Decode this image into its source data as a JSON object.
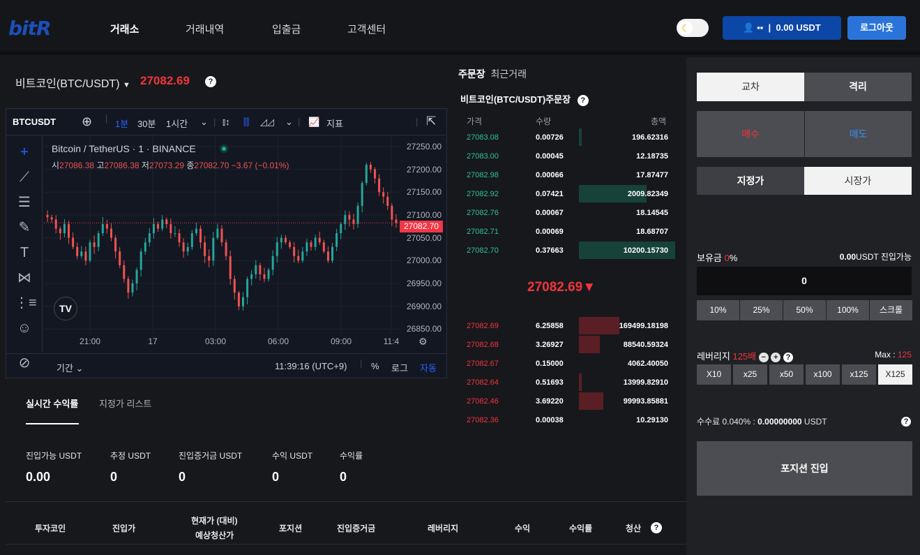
{
  "header": {
    "logo": "bitR",
    "nav": [
      "거래소",
      "거래내역",
      "입출금",
      "고객센터"
    ],
    "account_label": "0.00 USDT",
    "logout": "로그아웃"
  },
  "pair": {
    "title": "비트코인(BTC/USDT)",
    "price": "27082.69"
  },
  "chart": {
    "symbol": "BTCUSDT",
    "intervals": [
      "1분",
      "30분",
      "1시간"
    ],
    "indicator": "지표",
    "series_title": "Bitcoin / TetherUS · 1 · BINANCE",
    "ohlc": {
      "o_label": "시",
      "o": "27086.38",
      "h_label": "고",
      "h": "27086.38",
      "l_label": "저",
      "l": "27073.29",
      "c_label": "종",
      "c": "27082.70 −3.67 (−0.01%)"
    },
    "last_price_tag": "27082.70",
    "range_label": "기간",
    "time": "11:39:16 (UTC+9)",
    "percent": "%",
    "log": "로그",
    "auto": "자동"
  },
  "chart_data": {
    "type": "candlestick",
    "title": "Bitcoin / TetherUS · 1 · BINANCE",
    "x_ticks": [
      "21:00",
      "17",
      "03:00",
      "06:00",
      "09:00",
      "11:4"
    ],
    "y_ticks": [
      "27250.00",
      "27200.00",
      "27150.00",
      "27100.00",
      "27050.00",
      "27000.00",
      "26950.00",
      "26900.00",
      "26850.00"
    ],
    "ylim": [
      26840,
      27265
    ],
    "grid": true,
    "close_series": [
      27095,
      27090,
      27070,
      27060,
      27080,
      27050,
      27030,
      27010,
      27020,
      27000,
      27040,
      27030,
      27060,
      27080,
      27070,
      27050,
      27020,
      26990,
      26960,
      26930,
      26950,
      26980,
      27020,
      27040,
      27060,
      27080,
      27070,
      27090,
      27080,
      27060,
      27060,
      27040,
      27020,
      27030,
      27060,
      27070,
      27040,
      27010,
      27000,
      27050,
      27070,
      27040,
      27010,
      26960,
      26930,
      26900,
      26920,
      26960,
      26970,
      26990,
      26970,
      26960,
      26980,
      27010,
      27040,
      27050,
      27040,
      27030,
      27010,
      27000,
      27020,
      27040,
      27030,
      27050,
      27040,
      27020,
      27000,
      27030,
      27060,
      27080,
      27100,
      27090,
      27080,
      27120,
      27170,
      27210,
      27200,
      27180,
      27150,
      27140,
      27120,
      27090,
      27082
    ]
  },
  "orderbook": {
    "tab_active": "주문장",
    "tab_other": "최근거래",
    "title": "비트코인(BTC/USDT)주문장",
    "col_price": "가격",
    "col_qty": "수량",
    "col_total": "총액",
    "asks": [
      {
        "price": "27083.08",
        "qty": "0.00726",
        "total": "196.62316",
        "depth": 0.03
      },
      {
        "price": "27083.00",
        "qty": "0.00045",
        "total": "12.18735",
        "depth": 0.0
      },
      {
        "price": "27082.98",
        "qty": "0.00066",
        "total": "17.87477",
        "depth": 0.0
      },
      {
        "price": "27082.92",
        "qty": "0.07421",
        "total": "2009.82349",
        "depth": 0.7
      },
      {
        "price": "27082.76",
        "qty": "0.00067",
        "total": "18.14545",
        "depth": 0.0
      },
      {
        "price": "27082.71",
        "qty": "0.00069",
        "total": "18.68707",
        "depth": 0.0
      },
      {
        "price": "27082.70",
        "qty": "0.37663",
        "total": "10200.15730",
        "depth": 1.0
      }
    ],
    "mid_price": "27082.69▼",
    "bids": [
      {
        "price": "27082.69",
        "qty": "6.25858",
        "total": "169499.18198",
        "depth": 0.42
      },
      {
        "price": "27082.68",
        "qty": "3.26927",
        "total": "88540.59324",
        "depth": 0.22
      },
      {
        "price": "27082.67",
        "qty": "0.15000",
        "total": "4062.40050",
        "depth": 0.0
      },
      {
        "price": "27082.64",
        "qty": "0.51693",
        "total": "13999.82910",
        "depth": 0.03
      },
      {
        "price": "27082.46",
        "qty": "3.69220",
        "total": "99993.85881",
        "depth": 0.25
      },
      {
        "price": "27082.36",
        "qty": "0.00038",
        "total": "10.29130",
        "depth": 0.0
      }
    ]
  },
  "positions": {
    "tab_active": "실시간 수익률",
    "tab_other": "지정가 리스트",
    "stats": [
      {
        "label": "진입가능 USDT",
        "value": "0.00"
      },
      {
        "label": "추정 USDT",
        "value": "0"
      },
      {
        "label": "진입증거금 USDT",
        "value": "0"
      },
      {
        "label": "수익 USDT",
        "value": "0"
      },
      {
        "label": "수익률",
        "value": "0"
      }
    ],
    "columns": [
      "투자코인",
      "진입가",
      "현재가 (대비)",
      "예상청산가",
      "포지션",
      "진입증거금",
      "레버리지",
      "수익",
      "수익률",
      "청산"
    ]
  },
  "trade": {
    "margin_cross": "교차",
    "margin_isolated": "격리",
    "buy": "매수",
    "sell": "매도",
    "limit": "지정가",
    "market": "시장가",
    "balance_label": "보유금",
    "balance_pct": "0",
    "balance_pct_unit": "%",
    "available_value": "0.00",
    "available_suffix": "USDT 진입가능",
    "amount": "0",
    "pct_buttons": [
      "10%",
      "25%",
      "50%",
      "100%",
      "스크롤"
    ],
    "leverage_label": "레버리지",
    "leverage_value": "125배",
    "max_label": "Max :",
    "max_value": "125",
    "leverage_buttons": [
      "X10",
      "x25",
      "x50",
      "x100",
      "x125",
      "X125"
    ],
    "fee_label": "수수료 0.040% :",
    "fee_value": "0.00000000",
    "fee_unit": "USDT",
    "submit": "포지션 진입"
  },
  "colors": {
    "up": "#26a69a",
    "down": "#ef5350",
    "ask_text": "#2ec19a",
    "bid_text": "#f0353c",
    "accent": "#0c46a6"
  }
}
